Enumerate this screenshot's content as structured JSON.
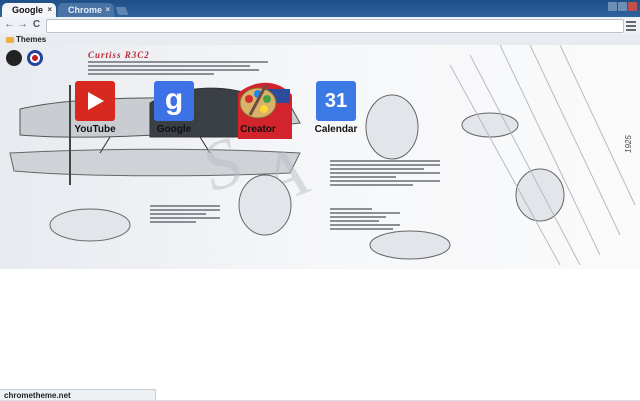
{
  "browser": {
    "tabs": [
      {
        "label": "Google",
        "active": true
      },
      {
        "label": "Chrome",
        "active": false
      }
    ],
    "tab_close_glyph": "×",
    "nav": {
      "back": "←",
      "forward": "→",
      "reload": "C"
    },
    "omnibox_value": ""
  },
  "bookmarks": [
    {
      "label": "Themes",
      "icon": "folder-icon"
    }
  ],
  "theme_art": {
    "title": "Curtiss R3C2",
    "year": "1925",
    "accent_color": "#b8282f"
  },
  "apps": [
    {
      "label": "YouTube",
      "icon": "youtube-icon",
      "color": "#d8281f"
    },
    {
      "label": "Google",
      "icon": "google-icon",
      "color": "#3d72e6"
    },
    {
      "label": "Creator",
      "icon": "creator-palette-icon",
      "color": "#c9a24a"
    },
    {
      "label": "Calendar",
      "icon": "calendar-icon",
      "color": "#3b7ae5",
      "day": "31"
    }
  ],
  "status": {
    "text": "chrometheme.net"
  }
}
